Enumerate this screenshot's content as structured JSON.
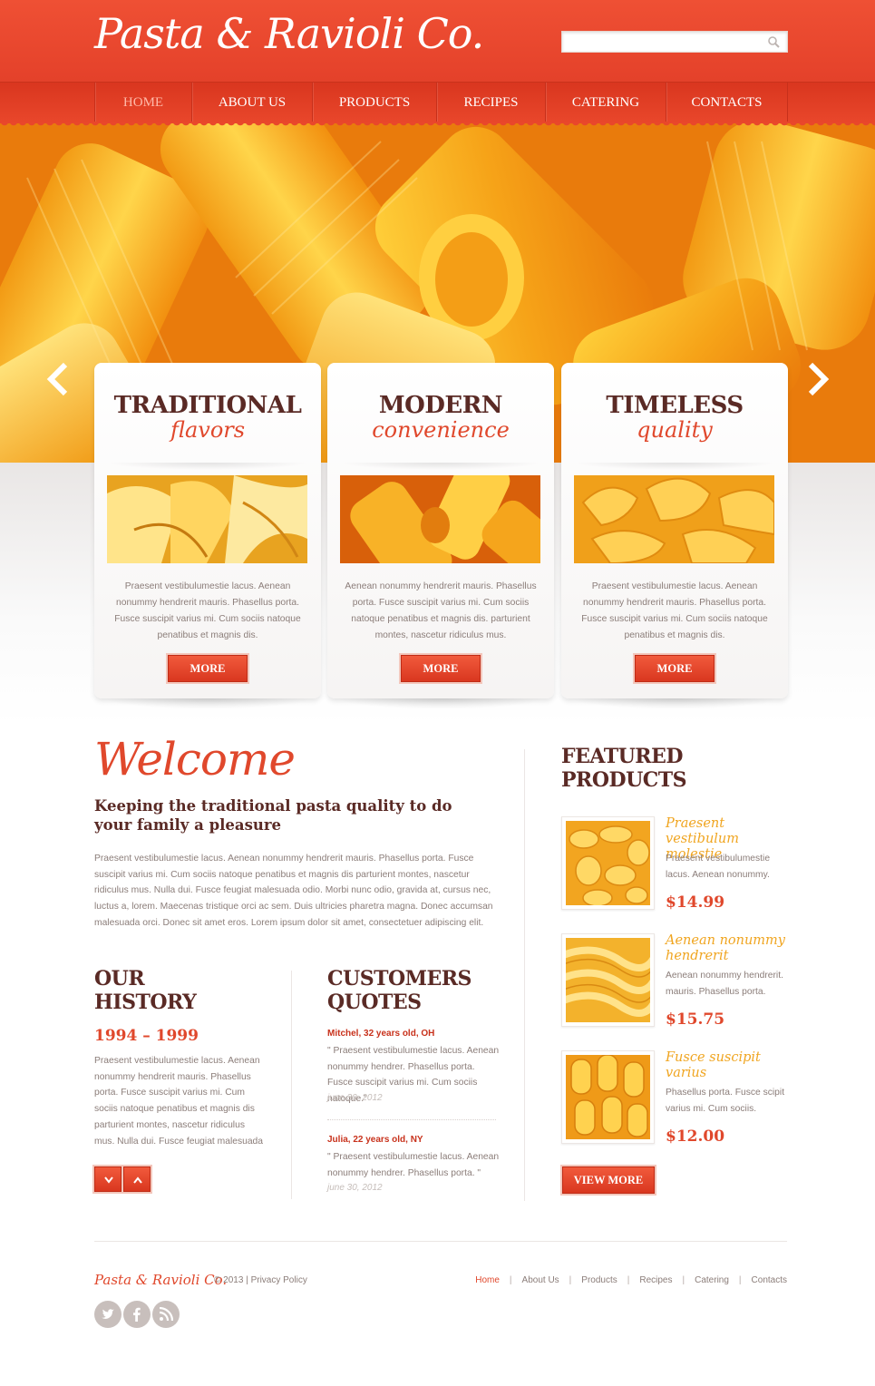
{
  "brand": {
    "name": "Pasta & Ravioli Co.",
    "accent": "#e8452a",
    "dark": "#5a2a25",
    "gold": "#f0a520"
  },
  "search": {
    "placeholder": "",
    "value": ""
  },
  "nav": [
    {
      "label": "Home",
      "active": true
    },
    {
      "label": "About Us"
    },
    {
      "label": "Products"
    },
    {
      "label": "Recipes"
    },
    {
      "label": "Catering"
    },
    {
      "label": "Contacts"
    }
  ],
  "features": [
    {
      "title": "TRADITIONAL",
      "subtitle": "flavors",
      "text": "Praesent vestibulumestie lacus. Aenean nonummy hendrerit mauris. Phasellus porta. Fusce suscipit varius mi. Cum sociis natoque penatibus et magnis dis.",
      "button": "More"
    },
    {
      "title": "MODERN",
      "subtitle": "convenience",
      "text": "Aenean nonummy hendrerit mauris. Phasellus porta. Fusce suscipit varius mi. Cum sociis natoque penatibus et magnis dis. parturient montes, nascetur ridiculus mus.",
      "button": "More"
    },
    {
      "title": "TIMELESS",
      "subtitle": "quality",
      "text": "Praesent vestibulumestie lacus. Aenean nonummy hendrerit mauris. Phasellus porta. Fusce suscipit varius mi. Cum sociis natoque penatibus et magnis dis.",
      "button": "More"
    }
  ],
  "welcome": {
    "title": "Welcome",
    "subtitle": "Keeping the traditional pasta quality to do your family a pleasure",
    "text": "Praesent vestibulumestie lacus. Aenean nonummy hendrerit mauris. Phasellus porta. Fusce suscipit varius mi. Cum sociis natoque penatibus et magnis dis parturient montes, nascetur ridiculus mus. Nulla dui. Fusce feugiat malesuada odio. Morbi nunc odio, gravida at, cursus nec, luctus a, lorem. Maecenas tristique orci ac sem. Duis ultricies pharetra magna. Donec accumsan malesuada orci. Donec sit amet eros. Lorem ipsum dolor sit amet, consectetuer adipiscing elit."
  },
  "history": {
    "title_line1": "OUR",
    "title_line2": "HISTORY",
    "years": "1994 – 1999",
    "text": "Praesent vestibulumestie lacus. Aenean nonummy hendrerit mauris. Phasellus porta. Fusce suscipit varius mi. Cum sociis natoque penatibus et magnis dis parturient montes, nascetur ridiculus mus. Nulla dui. Fusce feugiat malesuada"
  },
  "quotes": {
    "title_line1": "CUSTOMERS",
    "title_line2": "QUOTES",
    "items": [
      {
        "author": "Mitchel,  32 years old, OH",
        "text": "\" Praesent vestibulumestie lacus. Aenean nonummy hendrer. Phasellus porta. Fusce suscipit varius mi. Cum sociis natoque.\"",
        "date": "june 30, 2012"
      },
      {
        "author": "Julia,  22 years old, NY",
        "text": "\" Praesent vestibulumestie lacus. Aenean nonummy hendrer. Phasellus porta. \"",
        "date": "june 30, 2012"
      }
    ]
  },
  "featured": {
    "title_line1": "FEATURED",
    "title_line2": "PRODUCTS",
    "items": [
      {
        "name": "Praesent vestibulum molestie",
        "desc": "Praesent vestibulumestie lacus. Aenean nonummy.",
        "price": "$14.99"
      },
      {
        "name": "Aenean nonummy hendrerit",
        "desc": "Aenean nonummy hendrerit. mauris. Phasellus porta.",
        "price": "$15.75"
      },
      {
        "name": "Fusce suscipit varius",
        "desc": "Phasellus porta. Fusce scipit varius mi. Cum sociis.",
        "price": "$12.00"
      }
    ],
    "button": "View More"
  },
  "footer": {
    "logo": "Pasta & Ravioli Co.",
    "copyright": "© 2013",
    "privacy": "Privacy Policy",
    "links": [
      "Home",
      "About Us",
      "Products",
      "Recipes",
      "Catering",
      "Contacts"
    ],
    "social": [
      "twitter-icon",
      "facebook-icon",
      "rss-icon"
    ]
  }
}
